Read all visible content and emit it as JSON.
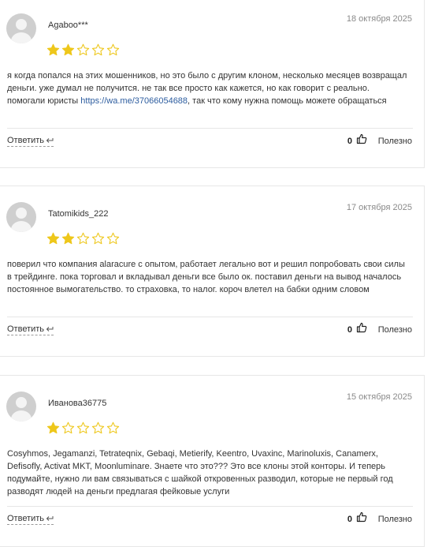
{
  "colors": {
    "star_filled": "#eec71b",
    "star_empty_stroke": "#eec71b",
    "link": "#2d5d9f",
    "date": "#8a8a8a"
  },
  "icons": {
    "avatar": "default-user-avatar",
    "reply": "reply-arrow-icon",
    "like": "thumbs-up-icon",
    "star": "star-icon"
  },
  "reviews": [
    {
      "author": "Agaboo***",
      "date": "18 октября 2025",
      "rating": 2,
      "max_rating": 5,
      "text_before_link": "я когда попался на этих мошенников, но это было с другим клоном, несколько месяцев возвращал деньги. уже думал не получится. не так все просто как кажется, но как говорит с реально. помогали юристы ",
      "link": "https://wa.me/37066054688",
      "text_after_link": ", так что кому нужна помощь можете обращаться",
      "reply_label": "Ответить",
      "likes": "0",
      "useful_label": "Полезно"
    },
    {
      "author": "Tatomikids_222",
      "date": "17 октября 2025",
      "rating": 2,
      "max_rating": 5,
      "text": "поверил что компания alaracure с опытом, работает легально вот и решил попробовать свои силы в трейдинге. пока торговал и вкладывал деньги все было ок. поставил деньги на вывод началось постоянное вымогательство. то страховка, то налог. короч влетел на бабки одним словом",
      "reply_label": "Ответить",
      "likes": "0",
      "useful_label": "Полезно"
    },
    {
      "author": "Иванова36775",
      "date": "15 октября 2025",
      "rating": 1,
      "max_rating": 5,
      "text": "Cosyhmos, Jegamanzi, Tetrateqnix, Gebaqi, Metierify, Keentro, Uvaxinc, Marinoluxis, Canamerx, Defisofly, Activat MKT, Moonluminare. Знаете что это??? Это все клоны этой конторы. И теперь подумайте, нужно ли вам связываться с шайкой откровенных разводил, которые не первый год разводят людей на деньги предлагая фейковые услуги",
      "reply_label": "Ответить",
      "likes": "0",
      "useful_label": "Полезно"
    }
  ]
}
